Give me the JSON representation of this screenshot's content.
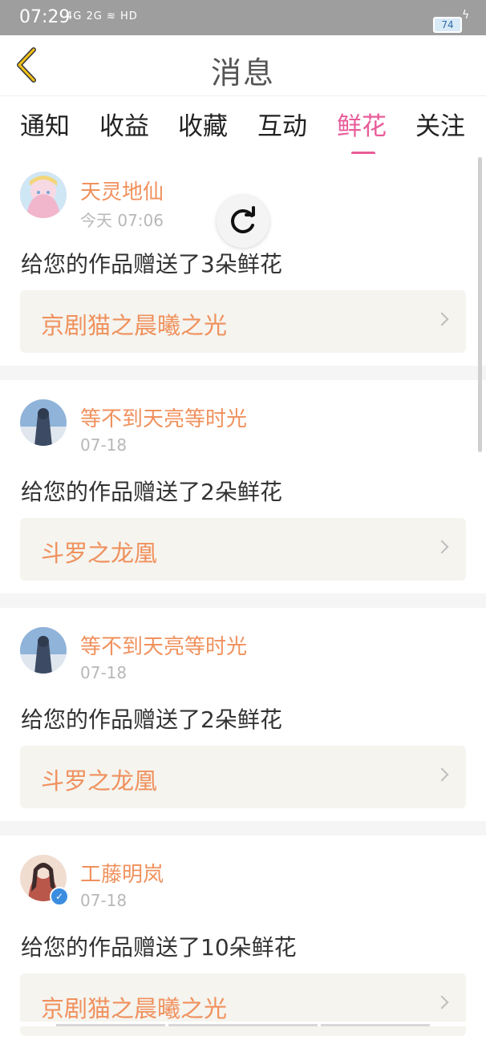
{
  "status_bar": {
    "time": "07:29",
    "signal_text": "4G 2G ≋ HD",
    "battery": "74"
  },
  "header": {
    "title": "消息"
  },
  "tabs": [
    {
      "label": "通知",
      "active": false
    },
    {
      "label": "收益",
      "active": false
    },
    {
      "label": "收藏",
      "active": false
    },
    {
      "label": "互动",
      "active": false
    },
    {
      "label": "鲜花",
      "active": true
    },
    {
      "label": "关注",
      "active": false
    }
  ],
  "feed": [
    {
      "username": "天灵地仙",
      "time": "今天 07:06",
      "message": "给您的作品赠送了3朵鲜花",
      "work_title": "京剧猫之晨曦之光",
      "avatar_color": "#f6c2d6",
      "verified": false
    },
    {
      "username": "等不到天亮等时光",
      "time": "07-18",
      "message": "给您的作品赠送了2朵鲜花",
      "work_title": "斗罗之龙凰",
      "avatar_color": "#5d7fa8",
      "verified": false
    },
    {
      "username": "等不到天亮等时光",
      "time": "07-18",
      "message": "给您的作品赠送了2朵鲜花",
      "work_title": "斗罗之龙凰",
      "avatar_color": "#5d7fa8",
      "verified": false
    },
    {
      "username": "工藤明岚",
      "time": "07-18",
      "message": "给您的作品赠送了10朵鲜花",
      "work_title": "京剧猫之晨曦之光",
      "avatar_color": "#b9574b",
      "verified": true
    }
  ],
  "colors": {
    "accent": "#e85c99",
    "name_orange": "#f0915d",
    "work_bg": "#f5f4ef"
  }
}
